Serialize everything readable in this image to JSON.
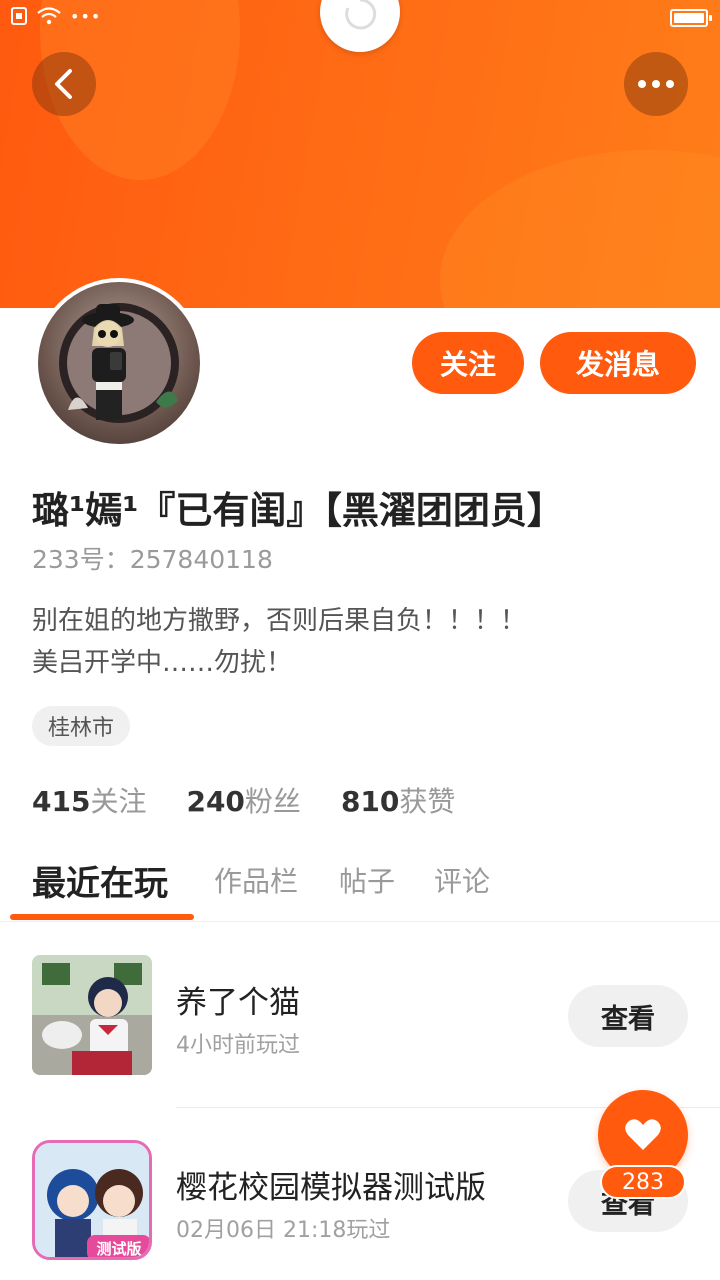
{
  "status_bar": {
    "dots": "•••"
  },
  "colors": {
    "accent": "#ff5a0e",
    "banner": "#ff6a14"
  },
  "profile": {
    "follow_label": "关注",
    "message_label": "发消息",
    "username": "璐¹嫣¹『已有闺』【黑濯团团员】",
    "uid": "233号：257840118",
    "bio_line1": "别在姐的地方撒野，否则后果自负！！！！",
    "bio_line2": "美吕开学中……勿扰！",
    "location": "桂林市"
  },
  "stats": [
    {
      "num": "415",
      "label": "关注"
    },
    {
      "num": "240",
      "label": "粉丝"
    },
    {
      "num": "810",
      "label": "获赞"
    }
  ],
  "tabs": [
    "最近在玩",
    "作品栏",
    "帖子",
    "评论"
  ],
  "games": [
    {
      "title": "养了个猫",
      "time": "4小时前玩过",
      "button": "查看"
    },
    {
      "title": "樱花校园模拟器测试版",
      "time": "02月06日 21:18玩过",
      "button": "查看",
      "badge": "测试版"
    }
  ],
  "like_count": "283"
}
